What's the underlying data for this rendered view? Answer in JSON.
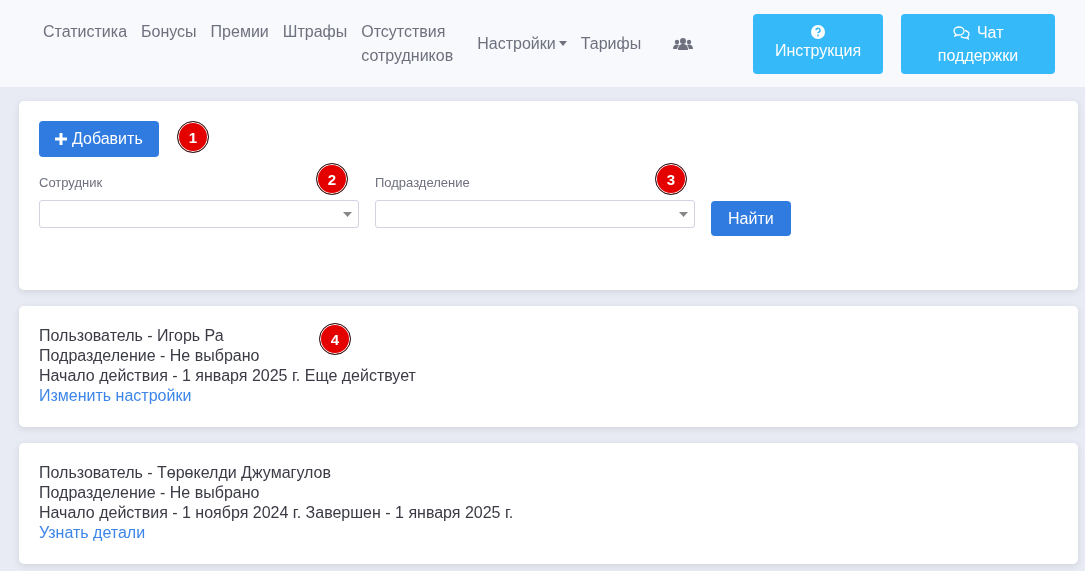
{
  "nav": {
    "items": [
      {
        "kind": "link",
        "label": "Статистика"
      },
      {
        "kind": "link",
        "label": "Бонусы"
      },
      {
        "kind": "link",
        "label": "Премии"
      },
      {
        "kind": "link",
        "label": "Штрафы"
      },
      {
        "kind": "link",
        "label": "Отсутствия сотрудников"
      },
      {
        "kind": "dropdown",
        "label": "Настройки"
      },
      {
        "kind": "link",
        "label": "Тарифы"
      },
      {
        "kind": "icon"
      }
    ],
    "buttons": [
      {
        "kind": "help",
        "label": "Инструкция"
      },
      {
        "kind": "chat",
        "label": "Чат поддержки"
      }
    ]
  },
  "filter": {
    "add_button": "Добавить",
    "fields": [
      {
        "label": "Сотрудник"
      },
      {
        "label": "Подразделение"
      }
    ],
    "find_button": "Найти"
  },
  "entries": [
    {
      "lines": [
        "Пользователь - Игорь Ра",
        "Подразделение - Не выбрано",
        "Начало действия - 1 января 2025 г. Еще действует"
      ],
      "link": "Изменить настройки"
    },
    {
      "lines": [
        "Пользователь - Төрөкелди Джумагулов",
        "Подразделение - Не выбрано",
        "Начало действия - 1 ноября 2024 г. Завершен - 1 января 2025 г."
      ],
      "link": "Узнать детали"
    }
  ],
  "callouts": [
    "1",
    "2",
    "3",
    "4"
  ]
}
